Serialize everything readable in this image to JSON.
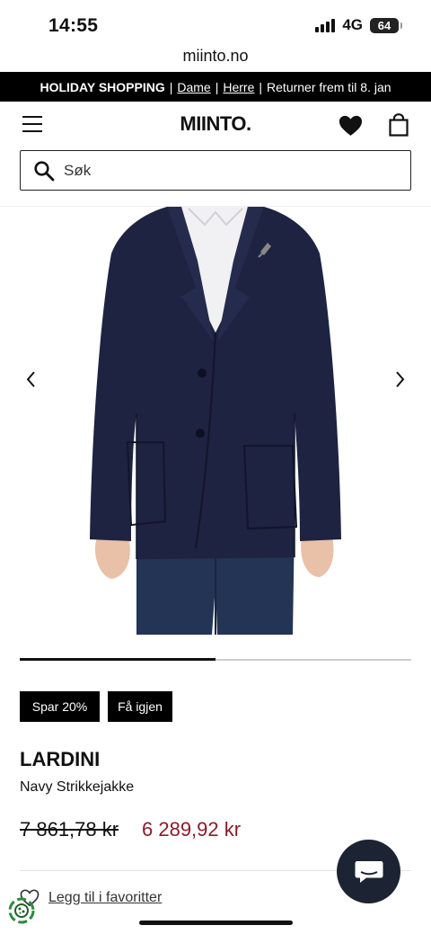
{
  "status_bar": {
    "time": "14:55",
    "network": "4G",
    "battery": "64"
  },
  "browser": {
    "url": "miinto.no"
  },
  "promo": {
    "title": "HOLIDAY SHOPPING",
    "link_women": "Dame",
    "link_men": "Herre",
    "returns_text": "Returner frem til 8. jan"
  },
  "header": {
    "logo": "MIINTO."
  },
  "search": {
    "placeholder": "Søk"
  },
  "gallery": {
    "image_index": 1,
    "image_count": 2
  },
  "badges": {
    "discount": "Spar 20%",
    "return": "Få igjen"
  },
  "product": {
    "brand": "LARDINI",
    "name": "Navy Strikkejakke",
    "price_old": "7 861,78 kr",
    "price_new": "6 289,92 kr"
  },
  "actions": {
    "favorite_label": "Legg til i favoritter"
  },
  "colors": {
    "sale_price": "#8b1a2b",
    "chat_button": "#1c2433",
    "banner": "#000000"
  }
}
